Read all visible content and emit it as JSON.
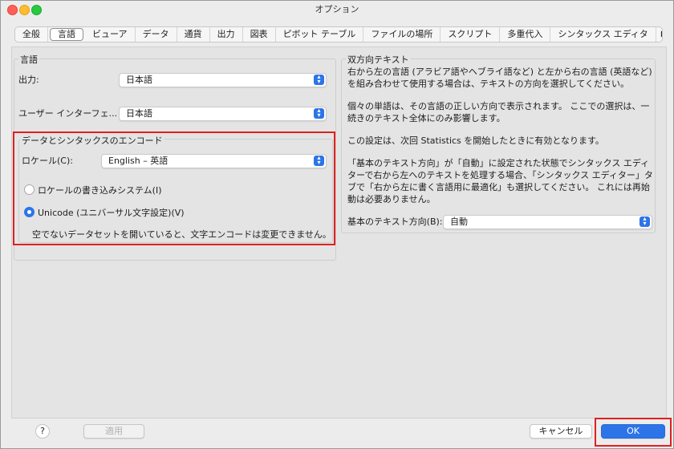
{
  "window": {
    "title": "オプション"
  },
  "tabs": [
    "全般",
    "言語",
    "ビューア",
    "データ",
    "通貨",
    "出力",
    "図表",
    "ピボット テーブル",
    "ファイルの場所",
    "スクリプト",
    "多重代入",
    "シンタックス エディタ",
    "▶"
  ],
  "selected_tab": "言語",
  "language_group": {
    "title": "言語",
    "output_label": "出力:",
    "output_value": "日本語",
    "ui_label": "ユーザー インターフェ...",
    "ui_value": "日本語"
  },
  "encoding_group": {
    "title": "データとシンタックスのエンコード",
    "locale_label": "ロケール(C):",
    "locale_value": "English – 英語",
    "radio_locale": "ロケールの書き込みシステム(I)",
    "radio_unicode": "Unicode (ユニバーサル文字設定)(V)",
    "note": "空でないデータセットを開いていると、文字エンコードは変更できません。"
  },
  "bidi_group": {
    "title": "双方向テキスト",
    "p1": "右から左の言語 (アラビア語やヘブライ語など) と左から右の言語 (英語など) を組み合わせて使用する場合は、テキストの方向を選択してください。",
    "p2": "個々の単語は、その言語の正しい方向で表示されます。 ここでの選択は、一続きのテキスト全体にのみ影響します。",
    "p3": "この設定は、次回 Statistics を開始したときに有効となります。",
    "p4": "「基本のテキスト方向」が「自動」に設定された状態でシンタックス エディターで右から左へのテキストを処理する場合、「シンタックス エディター」タブで「右から左に書く言語用に最適化」も選択してください。 これには再始動は必要ありません。",
    "direction_label": "基本のテキスト方向(B):",
    "direction_value": "自動"
  },
  "footer": {
    "help": "?",
    "apply": "適用",
    "cancel": "キャンセル",
    "ok": "OK"
  },
  "colors": {
    "accent": "#2c74e8",
    "highlight_box": "#e02020"
  },
  "icons": [
    "close-icon",
    "minimize-icon",
    "maximize-icon",
    "chevron-updown-icon",
    "help-icon"
  ]
}
